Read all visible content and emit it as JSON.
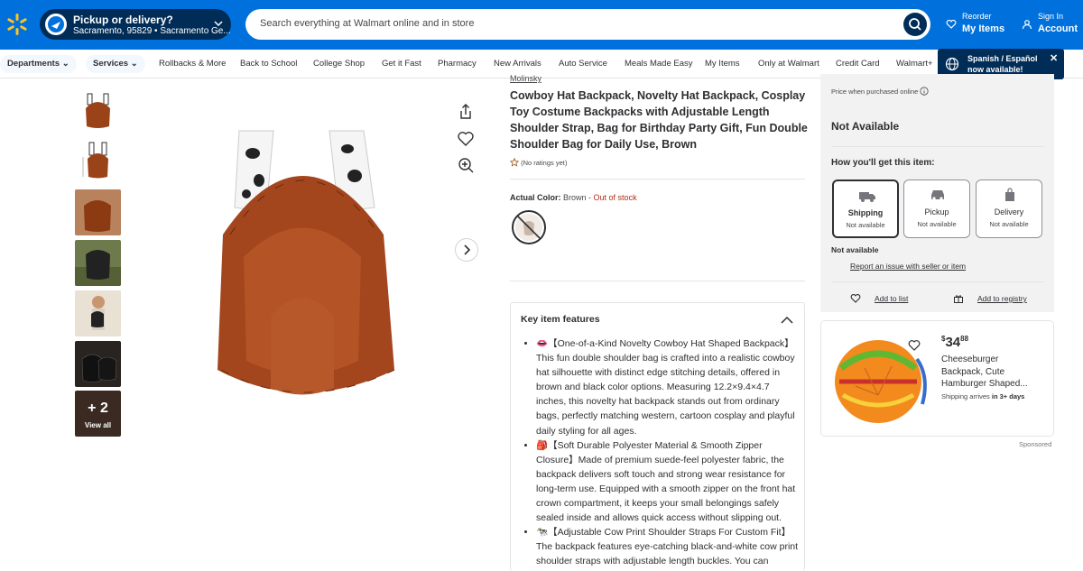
{
  "header": {
    "pickup_title": "Pickup or delivery?",
    "pickup_sub": "Sacramento, 95829 • Sacramento Ge...",
    "search_placeholder": "Search everything at Walmart online and in store",
    "reorder_small": "Reorder",
    "reorder_big": "My Items",
    "signin_small": "Sign In",
    "signin_big": "Account"
  },
  "nav": {
    "items": [
      "Departments",
      "Services",
      "Rollbacks & More",
      "Back to School",
      "College Shop",
      "Get it Fast",
      "Pharmacy",
      "New Arrivals",
      "Auto Service",
      "Meals Made Easy",
      "My Items",
      "Only at Walmart",
      "Credit Card",
      "Walmart+"
    ],
    "lang_line1": "Spanish / Español",
    "lang_line2": "now available!"
  },
  "gallery": {
    "view_all_count": "+ 2",
    "view_all_label": "View all"
  },
  "product": {
    "brand": "Molinsky",
    "title": "Cowboy Hat Backpack, Novelty Hat Backpack, Cosplay Toy Costume Backpacks with Adjustable Length Shoulder Strap, Bag for Birthday Party Gift, Fun Double Shoulder Bag for Daily Use, Brown",
    "rating_text": "(No ratings yet)",
    "color_label": "Actual Color:",
    "color_value": "Brown",
    "color_sep": " - ",
    "stock_status": "Out of stock",
    "features_title": "Key item features",
    "features": [
      "👄【One-of-a-Kind Novelty Cowboy Hat Shaped Backpack】This fun double shoulder bag is crafted into a realistic cowboy hat silhouette with distinct edge stitching details, offered in brown and black color options. Measuring 12.2×9.4×4.7 inches, this novelty hat backpack stands out from ordinary bags, perfectly matching western, cartoon cosplay and playful daily styling for all ages.",
      "🎒【Soft Durable Polyester Material & Smooth Zipper Closure】Made of premium suede-feel polyester fabric, the backpack delivers soft touch and strong wear resistance for long-term use. Equipped with a smooth zipper on the front hat crown compartment, it keeps your small belongings safely sealed inside and allows quick access without slipping out.",
      "🐄【Adjustable Cow Print Shoulder Straps For Custom Fit】The backpack features eye-catching black-and-white cow print shoulder straps with adjustable length buckles. You can"
    ]
  },
  "buybox": {
    "price_note": "Price when purchased online",
    "availability": "Not Available",
    "how_title": "How you'll get this item:",
    "options": [
      {
        "title": "Shipping",
        "sub": "Not available"
      },
      {
        "title": "Pickup",
        "sub": "Not available"
      },
      {
        "title": "Delivery",
        "sub": "Not available"
      }
    ],
    "not_available": "Not available",
    "report_link": "Report an issue with seller or item",
    "add_to_list": "Add to list",
    "add_to_registry": "Add to registry"
  },
  "ad": {
    "price_dollar": "$",
    "price_whole": "34",
    "price_cents": "88",
    "title": "Cheeseburger Backpack, Cute Hamburger Shaped...",
    "ship_prefix": "Shipping arrives ",
    "ship_when": "in 3+ days",
    "sponsored": "Sponsored"
  },
  "colors": {
    "walmart_blue": "#0071dc",
    "navy": "#002d58",
    "spark_yellow": "#ffc220",
    "out_of_stock": "#b32c14"
  }
}
